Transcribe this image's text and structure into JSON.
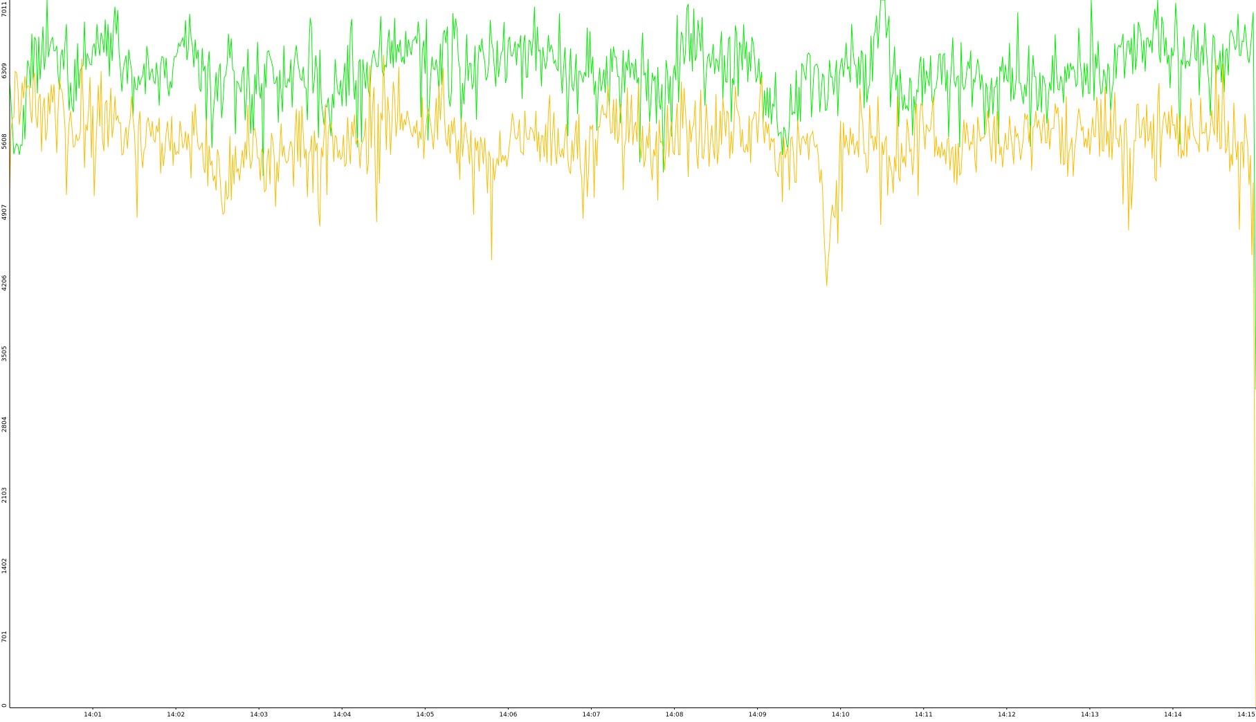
{
  "chart_data": {
    "type": "line",
    "title": "",
    "xlabel": "",
    "ylabel": "",
    "background": "#ffffff",
    "axis_color": "#000000",
    "tick_text_color": "#000000",
    "grid": false,
    "legend": "none",
    "xlim": [
      "14:00:00",
      "14:15:00"
    ],
    "ylim": [
      0,
      7011
    ],
    "x_ticks": [
      "14:01",
      "14:02",
      "14:03",
      "14:04",
      "14:05",
      "14:06",
      "14:07",
      "14:08",
      "14:09",
      "14:10",
      "14:11",
      "14:12",
      "14:13",
      "14:14",
      "14:15"
    ],
    "y_ticks": [
      "0",
      "701",
      "1402",
      "2103",
      "2804",
      "3505",
      "4206",
      "4907",
      "5608",
      "6309",
      "7011"
    ],
    "x_unit": "time (HH:MM:SS), 1 sample per second",
    "series": [
      {
        "color": "#00ee00",
        "keypoints": [
          [
            "14:00:00",
            6000
          ],
          [
            "14:00:05",
            5300
          ],
          [
            "14:00:15",
            6300
          ],
          [
            "14:00:30",
            6550
          ],
          [
            "14:00:45",
            6300
          ],
          [
            "14:01:00",
            6450
          ],
          [
            "14:01:15",
            6900
          ],
          [
            "14:01:30",
            6200
          ],
          [
            "14:01:45",
            6300
          ],
          [
            "14:02:00",
            6250
          ],
          [
            "14:02:10",
            6700
          ],
          [
            "14:02:25",
            6000
          ],
          [
            "14:02:40",
            6350
          ],
          [
            "14:02:55",
            6100
          ],
          [
            "14:03:10",
            6250
          ],
          [
            "14:03:20",
            6000
          ],
          [
            "14:03:35",
            6450
          ],
          [
            "14:03:50",
            5850
          ],
          [
            "14:04:05",
            6350
          ],
          [
            "14:04:20",
            6350
          ],
          [
            "14:04:35",
            6500
          ],
          [
            "14:04:50",
            6700
          ],
          [
            "14:05:05",
            6300
          ],
          [
            "14:05:20",
            6600
          ],
          [
            "14:05:35",
            6250
          ],
          [
            "14:05:50",
            6500
          ],
          [
            "14:06:05",
            6400
          ],
          [
            "14:06:20",
            6550
          ],
          [
            "14:06:35",
            6550
          ],
          [
            "14:06:50",
            6150
          ],
          [
            "14:07:05",
            6400
          ],
          [
            "14:07:20",
            6200
          ],
          [
            "14:07:35",
            6250
          ],
          [
            "14:07:50",
            6050
          ],
          [
            "14:08:05",
            6500
          ],
          [
            "14:08:20",
            6600
          ],
          [
            "14:08:35",
            6300
          ],
          [
            "14:08:50",
            6450
          ],
          [
            "14:09:05",
            6200
          ],
          [
            "14:09:20",
            5600
          ],
          [
            "14:09:35",
            6300
          ],
          [
            "14:09:50",
            6200
          ],
          [
            "14:10:05",
            6500
          ],
          [
            "14:10:20",
            6300
          ],
          [
            "14:10:30",
            6950
          ],
          [
            "14:10:45",
            6100
          ],
          [
            "14:11:00",
            6150
          ],
          [
            "14:11:15",
            6250
          ],
          [
            "14:11:30",
            6350
          ],
          [
            "14:11:45",
            6050
          ],
          [
            "14:12:00",
            6300
          ],
          [
            "14:12:15",
            6200
          ],
          [
            "14:12:30",
            6050
          ],
          [
            "14:12:45",
            6250
          ],
          [
            "14:13:00",
            6200
          ],
          [
            "14:13:15",
            6300
          ],
          [
            "14:13:30",
            6500
          ],
          [
            "14:13:45",
            6600
          ],
          [
            "14:14:00",
            6550
          ],
          [
            "14:14:15",
            6600
          ],
          [
            "14:14:30",
            6400
          ],
          [
            "14:14:45",
            6550
          ],
          [
            "14:14:58",
            6450
          ],
          [
            "14:15:00",
            3150
          ]
        ]
      },
      {
        "color": "#ffbb00",
        "keypoints": [
          [
            "14:00:00",
            5700
          ],
          [
            "14:00:10",
            6150
          ],
          [
            "14:00:25",
            5900
          ],
          [
            "14:00:40",
            5850
          ],
          [
            "14:00:55",
            5750
          ],
          [
            "14:01:10",
            5900
          ],
          [
            "14:01:25",
            5700
          ],
          [
            "14:01:40",
            5600
          ],
          [
            "14:02:00",
            5650
          ],
          [
            "14:02:15",
            5700
          ],
          [
            "14:02:25",
            5300
          ],
          [
            "14:02:40",
            5200
          ],
          [
            "14:02:55",
            5500
          ],
          [
            "14:03:10",
            5400
          ],
          [
            "14:03:25",
            5650
          ],
          [
            "14:03:40",
            5500
          ],
          [
            "14:03:55",
            5600
          ],
          [
            "14:04:10",
            5550
          ],
          [
            "14:04:25",
            5700
          ],
          [
            "14:04:35",
            6000
          ],
          [
            "14:04:50",
            5700
          ],
          [
            "14:05:05",
            5900
          ],
          [
            "14:05:20",
            5600
          ],
          [
            "14:05:35",
            5500
          ],
          [
            "14:05:50",
            5300
          ],
          [
            "14:06:05",
            5700
          ],
          [
            "14:06:20",
            5800
          ],
          [
            "14:06:35",
            5550
          ],
          [
            "14:06:50",
            5450
          ],
          [
            "14:07:05",
            5750
          ],
          [
            "14:07:20",
            5800
          ],
          [
            "14:07:35",
            5700
          ],
          [
            "14:07:50",
            5500
          ],
          [
            "14:08:05",
            5700
          ],
          [
            "14:08:20",
            5650
          ],
          [
            "14:08:35",
            5750
          ],
          [
            "14:08:50",
            5650
          ],
          [
            "14:09:05",
            5900
          ],
          [
            "14:09:15",
            5300
          ],
          [
            "14:09:30",
            5600
          ],
          [
            "14:09:45",
            5500
          ],
          [
            "14:09:50",
            4250
          ],
          [
            "14:10:00",
            5600
          ],
          [
            "14:10:15",
            5800
          ],
          [
            "14:10:30",
            5400
          ],
          [
            "14:10:45",
            5550
          ],
          [
            "14:11:00",
            5800
          ],
          [
            "14:11:15",
            5600
          ],
          [
            "14:11:30",
            5500
          ],
          [
            "14:11:45",
            5750
          ],
          [
            "14:12:00",
            5500
          ],
          [
            "14:12:15",
            5650
          ],
          [
            "14:12:30",
            5850
          ],
          [
            "14:12:45",
            5500
          ],
          [
            "14:13:00",
            5700
          ],
          [
            "14:13:15",
            5800
          ],
          [
            "14:13:30",
            5550
          ],
          [
            "14:13:45",
            5800
          ],
          [
            "14:14:00",
            5700
          ],
          [
            "14:14:15",
            5750
          ],
          [
            "14:14:30",
            5800
          ],
          [
            "14:14:45",
            5550
          ],
          [
            "14:14:58",
            5450
          ],
          [
            "14:15:00",
            0
          ]
        ]
      }
    ]
  }
}
